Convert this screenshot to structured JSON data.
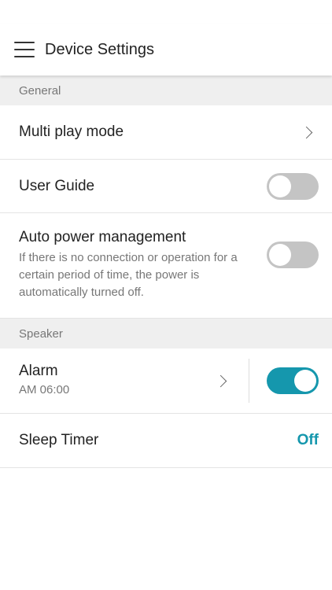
{
  "header": {
    "title": "Device Settings"
  },
  "sections": {
    "general": {
      "title": "General",
      "multi_play_mode": {
        "label": "Multi play mode"
      },
      "user_guide": {
        "label": "User Guide",
        "enabled": false
      },
      "auto_power": {
        "label": "Auto power management",
        "description": "If there is no connection or operation for a certain period of time, the power is automatically turned off.",
        "enabled": false
      }
    },
    "speaker": {
      "title": "Speaker",
      "alarm": {
        "label": "Alarm",
        "time": "AM 06:00",
        "enabled": true
      },
      "sleep_timer": {
        "label": "Sleep Timer",
        "value": "Off"
      }
    }
  },
  "colors": {
    "accent": "#1597ad",
    "toggle_off": "#c4c4c4",
    "section_bg": "#efefef"
  },
  "icons": {
    "menu": "hamburger-menu-icon",
    "chevron": "chevron-right-icon"
  }
}
